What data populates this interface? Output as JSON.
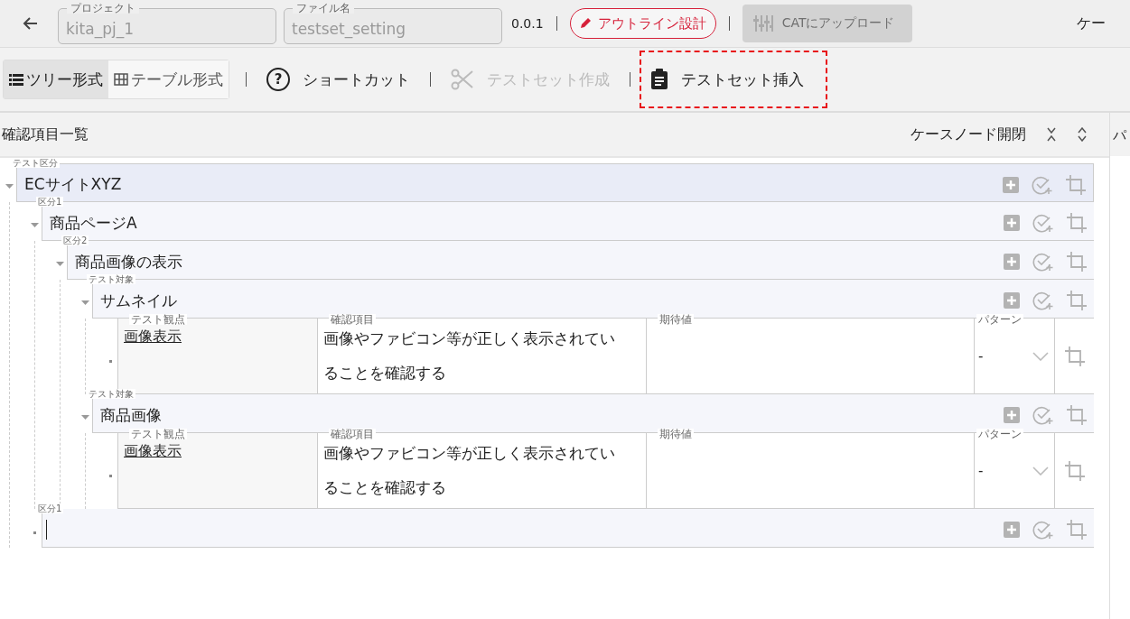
{
  "header": {
    "fields": [
      {
        "label": "プロジェクト",
        "value": "kita_pj_1",
        "disabled": true
      },
      {
        "label": "ファイル名",
        "value": "testset_setting",
        "disabled": true
      }
    ],
    "version": "0.0.1",
    "outline_button": "アウトライン設計",
    "upload_button": {
      "label": "CATにアップロード",
      "disabled": true
    },
    "edge_text": "ケー"
  },
  "toolbar": {
    "view_tabs": [
      {
        "label": "ツリー形式",
        "selected": true
      },
      {
        "label": "テーブル形式",
        "selected": false
      }
    ],
    "actions": [
      {
        "kind": "help",
        "icon": "?",
        "label": "ショートカット",
        "disabled": false,
        "highlighted": false
      },
      {
        "kind": "cut",
        "label": "テストセット作成",
        "disabled": true,
        "highlighted": false
      },
      {
        "kind": "insert",
        "label": "テストセット挿入",
        "disabled": false,
        "highlighted": true
      }
    ]
  },
  "panel": {
    "title": "確認項目一覧",
    "toggle_label": "ケースノード開閉",
    "side_text": "パ"
  },
  "tree": [
    {
      "kind": "group",
      "label": "テスト区分",
      "value": "ECサイトXYZ",
      "expanded": true,
      "children": [
        {
          "kind": "group",
          "label": "区分1",
          "value": "商品ページA",
          "expanded": true,
          "children": [
            {
              "kind": "group",
              "label": "区分2",
              "value": "商品画像の表示",
              "expanded": true,
              "children": [
                {
                  "kind": "group",
                  "label": "テスト対象",
                  "value": "サムネイル",
                  "expanded": true,
                  "children": [
                    {
                      "kind": "case",
                      "viewpoint_label": "テスト観点",
                      "viewpoint": "画像表示",
                      "check_label": "確認項目",
                      "check": "画像やファビコン等が正しく表示されていることを確認する",
                      "expected_label": "期待値",
                      "pattern_label": "パターン",
                      "pattern": "-"
                    }
                  ]
                },
                {
                  "kind": "group",
                  "label": "テスト対象",
                  "value": "商品画像",
                  "expanded": true,
                  "children": [
                    {
                      "kind": "case",
                      "viewpoint_label": "テスト観点",
                      "viewpoint": "画像表示",
                      "check_label": "確認項目",
                      "check": "画像やファビコン等が正しく表示されていることを確認する",
                      "expected_label": "期待値",
                      "pattern_label": "パターン",
                      "pattern": "-"
                    }
                  ]
                }
              ]
            }
          ]
        },
        {
          "kind": "group",
          "label": "区分1",
          "editing": true
        }
      ]
    }
  ]
}
